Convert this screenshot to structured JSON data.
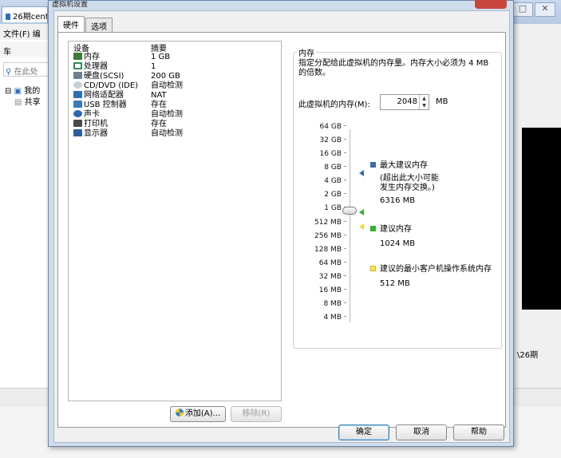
{
  "background": {
    "tab_title": "26期cent",
    "menu_text": "文件(F)  编",
    "toolbar_text": "车",
    "search_placeholder": "在此处",
    "tree_items": [
      "我的",
      "共享"
    ],
    "right_text": "\\26期"
  },
  "dialog": {
    "title": "虚拟机设置",
    "tabs": [
      {
        "label": "硬件",
        "active": true
      },
      {
        "label": "选项",
        "active": false
      }
    ],
    "device_list": {
      "header_device": "设备",
      "header_summary": "摘要",
      "items": [
        {
          "device": "内存",
          "summary": "1 GB",
          "icon": "memory-icon",
          "color": "#3a7d3a"
        },
        {
          "device": "处理器",
          "summary": "1",
          "icon": "cpu-icon",
          "color": "#2e8b57"
        },
        {
          "device": "硬盘(SCSI)",
          "summary": "200 GB",
          "icon": "hard-disk-icon",
          "color": "#6f7f90"
        },
        {
          "device": "CD/DVD (IDE)",
          "summary": "自动检测",
          "icon": "cd-dvd-icon",
          "color": "#9aa9b8"
        },
        {
          "device": "网络适配器",
          "summary": "NAT",
          "icon": "network-adapter-icon",
          "color": "#2f6fb5"
        },
        {
          "device": "USB 控制器",
          "summary": "存在",
          "icon": "usb-icon",
          "color": "#3b78b8"
        },
        {
          "device": "声卡",
          "summary": "自动检测",
          "icon": "sound-card-icon",
          "color": "#2a66b0"
        },
        {
          "device": "打印机",
          "summary": "存在",
          "icon": "printer-icon",
          "color": "#4a4a4a"
        },
        {
          "device": "显示器",
          "summary": "自动检测",
          "icon": "display-icon",
          "color": "#2c5e9e"
        }
      ]
    },
    "add_button": "添加(A)...",
    "remove_button": "移除(R)",
    "memory": {
      "group_title": "内存",
      "description": "指定分配给此虚拟机的内存量。内存大小必须为 4 MB 的倍数。",
      "field_label": "此虚拟机的内存(M):",
      "value": "2048",
      "unit": "MB",
      "scale_ticks": [
        "64 GB",
        "32 GB",
        "16 GB",
        "8 GB",
        "4 GB",
        "2 GB",
        "1 GB",
        "512 MB",
        "256 MB",
        "128 MB",
        "64 MB",
        "32 MB",
        "16 MB",
        "8 MB",
        "4 MB"
      ],
      "legend": {
        "max_label": "最大建议内存",
        "max_note_1": "(超出此大小可能",
        "max_note_2": "发生内存交换。)",
        "max_value": "6316 MB",
        "recommended_label": "建议内存",
        "recommended_value": "1024 MB",
        "min_label": "建议的最小客户机操作系统内存",
        "min_value": "512 MB"
      },
      "colors": {
        "max": "#3b6aa3",
        "recommended": "#2db32d",
        "min": "#f3d63a"
      }
    },
    "footer": {
      "ok": "确定",
      "cancel": "取消",
      "help": "帮助"
    }
  }
}
